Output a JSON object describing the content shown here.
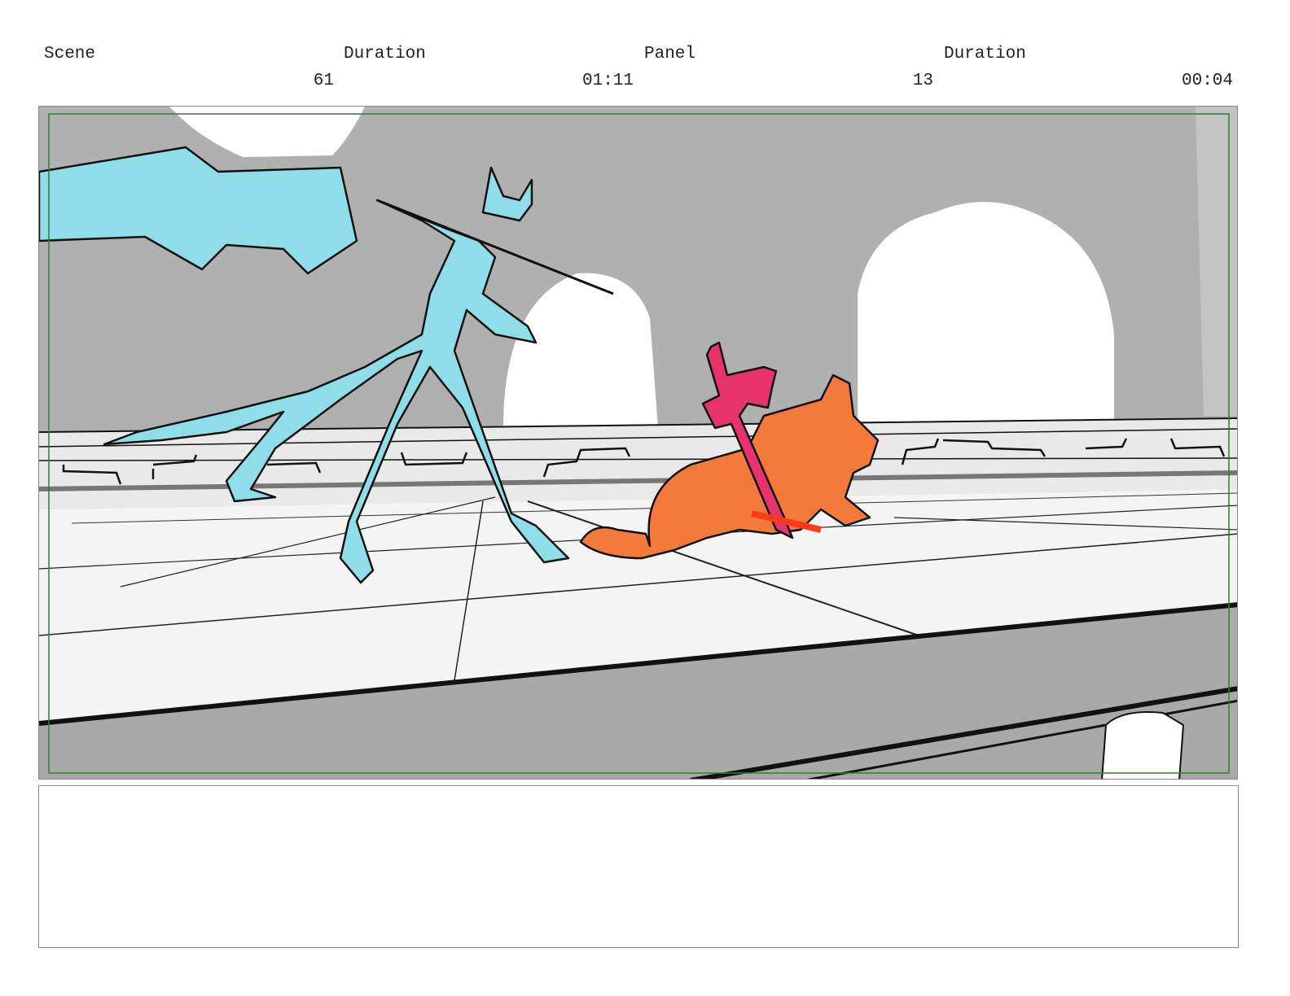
{
  "header": {
    "scene_label": "Scene",
    "scene_duration_label": "Duration",
    "panel_label": "Panel",
    "panel_duration_label": "Duration",
    "scene_number": "61",
    "scene_duration": "01:11",
    "panel_number": "13",
    "panel_duration": "00:04"
  },
  "panel": {
    "safe_frame_color": "#2e7d32",
    "colors": {
      "background_wall": "#b0b0b0",
      "arch_opening": "#ffffff",
      "floor": "#f4f4f4",
      "ledge_face": "#a9a9a9",
      "figure_left": "#8fdde8",
      "figure_right": "#f47a3c",
      "sword": "#e6336b",
      "ink": "#111111"
    }
  },
  "notes": {
    "text": ""
  }
}
